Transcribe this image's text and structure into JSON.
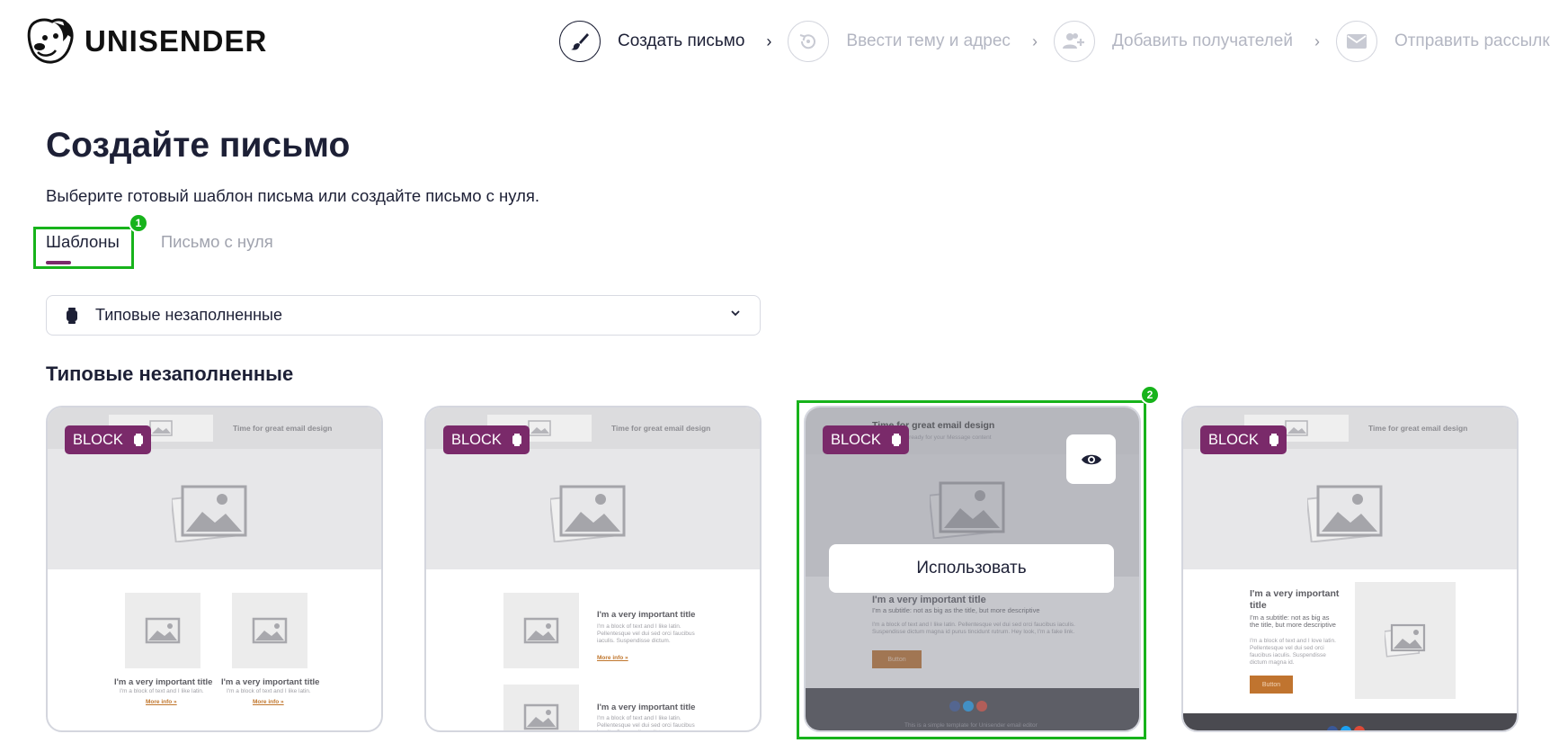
{
  "brand": {
    "name": "UNISENDER"
  },
  "steps": [
    {
      "label": "Создать письмо",
      "icon": "brush-icon",
      "active": true
    },
    {
      "label": "Ввести тему и адрес",
      "icon": "history-icon",
      "active": false
    },
    {
      "label": "Добавить получателей",
      "icon": "add-users-icon",
      "active": false
    },
    {
      "label": "Отправить рассылку",
      "icon": "envelope-icon",
      "active": false
    }
  ],
  "page": {
    "title": "Создайте письмо",
    "subtitle": "Выберите готовый шаблон письма или создайте письмо с нуля."
  },
  "tabs": [
    {
      "label": "Шаблоны",
      "active": true
    },
    {
      "label": "Письмо с нуля",
      "active": false
    }
  ],
  "annotations": {
    "tabs_badge": "1",
    "card_badge": "2"
  },
  "filter": {
    "selected": "Типовые незаполненные",
    "icon": "watch-icon"
  },
  "section_title": "Типовые незаполненные",
  "templates": [
    {
      "badge": "BLOCK",
      "header_text": "Time for great email design",
      "items": [
        {
          "title": "I'm a very important title",
          "text": "I'm a block of text and I like latin.",
          "link": "More info »"
        },
        {
          "title": "I'm a very important title",
          "text": "I'm a block of text and I like latin.",
          "link": "More info »"
        }
      ]
    },
    {
      "badge": "BLOCK",
      "header_text": "Time for great email design",
      "items": [
        {
          "title": "I'm a very important title",
          "text": "I'm a block of text and I like latin. Pellentesque vel dui sed orci faucibus iaculis. Suspendisse dictum.",
          "link": "More info »"
        },
        {
          "title": "I'm a very important title",
          "text": "I'm a block of text and I like latin. Pellentesque vel dui sed orci faucibus iaculis. Suspendisse dictum."
        }
      ]
    },
    {
      "badge": "BLOCK",
      "header_text": "Time for great email design",
      "header_sub": "Get this block ready for your Message content",
      "title": "I'm a very important title",
      "subtitle": "I'm a subtitle: not as big as the title, but more descriptive",
      "text": "I'm a block of text and I like latin. Pellentesque vel dui sed orci faucibus iaculis. Suspendisse dictum magna id purus tincidunt rutrum. Hey look, I'm a fake link.",
      "button": "Button",
      "footer_text": "This is a simple template for Unisender email editor",
      "use_label": "Использовать"
    },
    {
      "badge": "BLOCK",
      "header_text": "Time for great email design",
      "title": "I'm a very important title",
      "subtitle": "I'm a subtitle: not as big as the title, but more descriptive",
      "text": "I'm a block of text and I love latin. Pellentesque vel dui sed orci faucibus iaculis. Suspendisse dictum magna id.",
      "button": "Button"
    }
  ]
}
